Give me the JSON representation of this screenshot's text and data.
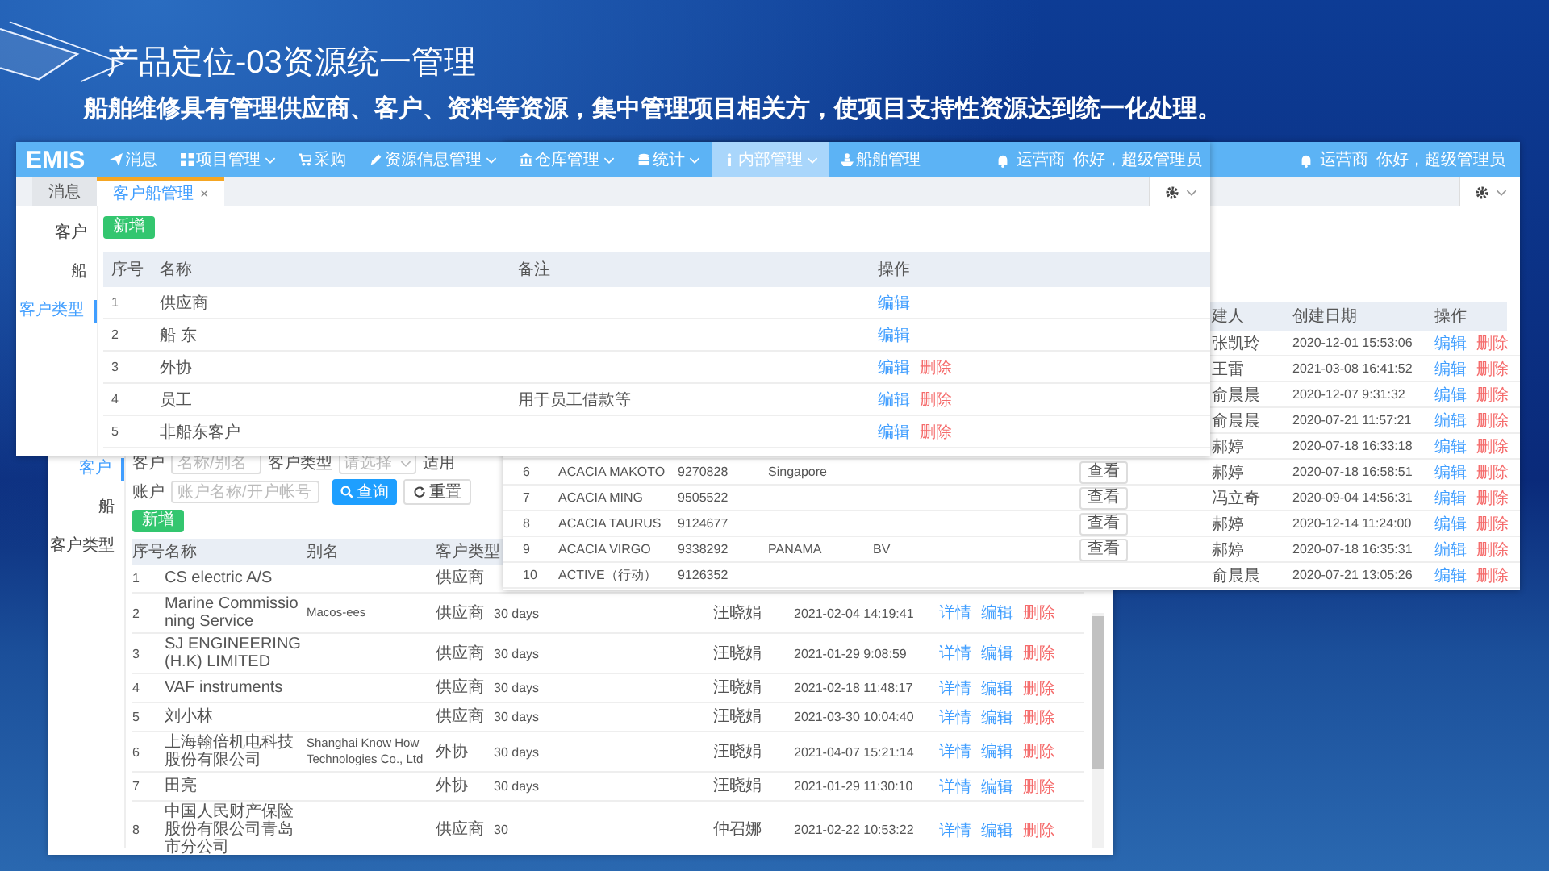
{
  "slide": {
    "title": "产品定位-03资源统一管理",
    "subtitle": "船舶维修具有管理供应商、客户、资料等资源，集中管理项目相关方，使项目支持性资源达到统一化处理。"
  },
  "customer_type_window": {
    "logo": "EMIS",
    "menu": [
      {
        "label": "消息",
        "dropdown": false,
        "selected": false
      },
      {
        "label": "项目管理",
        "dropdown": true,
        "selected": false
      },
      {
        "label": "采购",
        "dropdown": false,
        "selected": false
      },
      {
        "label": "资源信息管理",
        "dropdown": true,
        "selected": false
      },
      {
        "label": "仓库管理",
        "dropdown": true,
        "selected": false
      },
      {
        "label": "统计",
        "dropdown": true,
        "selected": false
      },
      {
        "label": "内部管理",
        "dropdown": true,
        "selected": true
      },
      {
        "label": "船舶管理",
        "dropdown": false,
        "selected": false
      }
    ],
    "operator": "运营商",
    "greeting": "你好，超级管理员",
    "tabs": [
      {
        "label": "消息",
        "selected": false
      },
      {
        "label": "客户船管理",
        "selected": true,
        "close": "×"
      }
    ],
    "sidebar": [
      {
        "label": "客户",
        "selected": false
      },
      {
        "label": "船",
        "selected": false
      },
      {
        "label": "客户类型",
        "selected": true
      }
    ],
    "add_button": "新增",
    "columns": [
      "序号",
      "名称",
      "备注",
      "操作"
    ],
    "rows": [
      {
        "number": "1",
        "name": "供应商",
        "remark": "",
        "actions": [
          {
            "label": "编辑",
            "kind": "edit"
          }
        ]
      },
      {
        "number": "2",
        "name": "船 东",
        "remark": "",
        "actions": [
          {
            "label": "编辑",
            "kind": "edit"
          }
        ]
      },
      {
        "number": "3",
        "name": "外协",
        "remark": "",
        "actions": [
          {
            "label": "编辑",
            "kind": "edit"
          },
          {
            "label": "删除",
            "kind": "delete"
          }
        ]
      },
      {
        "number": "4",
        "name": "员工",
        "remark": "用于员工借款等",
        "actions": [
          {
            "label": "编辑",
            "kind": "edit"
          },
          {
            "label": "删除",
            "kind": "delete"
          }
        ]
      },
      {
        "number": "5",
        "name": "非船东客户",
        "remark": "",
        "actions": [
          {
            "label": "编辑",
            "kind": "edit"
          },
          {
            "label": "删除",
            "kind": "delete"
          }
        ]
      }
    ]
  },
  "ship_window": {
    "operator": "运营商",
    "greeting": "你好，超级管理员",
    "columns": [
      "建人",
      "创建日期",
      "操作"
    ],
    "rows": [
      {
        "creator": "张凯玲",
        "created": "2020-12-01 15:53:06",
        "actions": [
          {
            "label": "编辑",
            "kind": "edit"
          },
          {
            "label": "删除",
            "kind": "delete"
          }
        ]
      },
      {
        "creator": "王雷",
        "created": "2021-03-08 16:41:52",
        "actions": [
          {
            "label": "编辑",
            "kind": "edit"
          },
          {
            "label": "删除",
            "kind": "delete"
          }
        ]
      },
      {
        "creator": "俞晨晨",
        "created": "2020-12-07 9:31:32",
        "actions": [
          {
            "label": "编辑",
            "kind": "edit"
          },
          {
            "label": "删除",
            "kind": "delete"
          }
        ]
      },
      {
        "creator": "俞晨晨",
        "created": "2020-07-21 11:57:21",
        "actions": [
          {
            "label": "编辑",
            "kind": "edit"
          },
          {
            "label": "删除",
            "kind": "delete"
          }
        ]
      },
      {
        "creator": "郝婷",
        "created": "2020-07-18 16:33:18",
        "actions": [
          {
            "label": "编辑",
            "kind": "edit"
          },
          {
            "label": "删除",
            "kind": "delete"
          }
        ]
      },
      {
        "number": "6",
        "name": "ACACIA MAKOTO",
        "imo": "9270828",
        "country": "Singapore",
        "view_button": "查看",
        "creator": "郝婷",
        "created": "2020-07-18 16:58:51",
        "actions": [
          {
            "label": "编辑",
            "kind": "edit"
          },
          {
            "label": "删除",
            "kind": "delete"
          }
        ]
      },
      {
        "number": "7",
        "name": "ACACIA MING",
        "imo": "9505522",
        "view_button": "查看",
        "creator": "冯立奇",
        "created": "2020-09-04 14:56:31",
        "actions": [
          {
            "label": "编辑",
            "kind": "edit"
          },
          {
            "label": "删除",
            "kind": "delete"
          }
        ]
      },
      {
        "number": "8",
        "name": "ACACIA TAURUS",
        "imo": "9124677",
        "view_button": "查看",
        "creator": "郝婷",
        "created": "2020-12-14 11:24:00",
        "actions": [
          {
            "label": "编辑",
            "kind": "edit"
          },
          {
            "label": "删除",
            "kind": "delete"
          }
        ]
      },
      {
        "number": "9",
        "name": "ACACIA VIRGO",
        "imo": "9338292",
        "country": "PANAMA",
        "flag": "BV",
        "view_button": "查看",
        "creator": "郝婷",
        "created": "2020-07-18 16:35:31",
        "actions": [
          {
            "label": "编辑",
            "kind": "edit"
          },
          {
            "label": "删除",
            "kind": "delete"
          }
        ]
      },
      {
        "number": "10",
        "name": "ACTIVE（行动）",
        "imo": "9126352",
        "creator": "俞晨晨",
        "created": "2020-07-21 13:05:26",
        "actions": [
          {
            "label": "编辑",
            "kind": "edit"
          },
          {
            "label": "删除",
            "kind": "delete"
          }
        ]
      }
    ]
  },
  "customer_window": {
    "sidebar": [
      {
        "label": "客户",
        "selected": true
      },
      {
        "label": "船",
        "selected": false
      },
      {
        "label": "客户类型",
        "selected": false
      }
    ],
    "filter_rows": [
      [
        {
          "kind": "input",
          "label": "客户",
          "placeholder": "名称/别名"
        },
        {
          "kind": "select",
          "label": "客户类型",
          "placeholder": "请选择"
        },
        {
          "kind": "cut_label",
          "label": "适用"
        }
      ],
      [
        {
          "kind": "input",
          "label": "账户",
          "placeholder": "账户名称/开户帐号"
        },
        {
          "kind": "search_button",
          "label": "查询"
        },
        {
          "kind": "reset_button",
          "label": "重置"
        }
      ]
    ],
    "add_button": "新增",
    "columns": [
      "序号",
      "名称",
      "别名",
      "客户类型"
    ],
    "rows": [
      {
        "number": "1",
        "name": "CS electric A/S",
        "alias": "",
        "type": "供应商"
      },
      {
        "number": "2",
        "name": "Marine Commissioning Service",
        "alias": "Macos-ees",
        "type": "供应商",
        "terms": "30 days",
        "person": "汪晓娟",
        "date": "2021-02-04 14:19:41",
        "actions": [
          {
            "label": "详情",
            "kind": "detail"
          },
          {
            "label": "编辑",
            "kind": "edit"
          },
          {
            "label": "删除",
            "kind": "delete"
          }
        ]
      },
      {
        "number": "3",
        "name": "SJ ENGINEERING(H.K) LIMITED",
        "alias": "",
        "type": "供应商",
        "terms": "30 days",
        "person": "汪晓娟",
        "date": "2021-01-29 9:08:59",
        "actions": [
          {
            "label": "详情",
            "kind": "detail"
          },
          {
            "label": "编辑",
            "kind": "edit"
          },
          {
            "label": "删除",
            "kind": "delete"
          }
        ]
      },
      {
        "number": "4",
        "name": "VAF instruments",
        "alias": "",
        "type": "供应商",
        "terms": "30 days",
        "person": "汪晓娟",
        "date": "2021-02-18 11:48:17",
        "actions": [
          {
            "label": "详情",
            "kind": "detail"
          },
          {
            "label": "编辑",
            "kind": "edit"
          },
          {
            "label": "删除",
            "kind": "delete"
          }
        ]
      },
      {
        "number": "5",
        "name": "刘小林",
        "alias": "",
        "type": "供应商",
        "terms": "30 days",
        "person": "汪晓娟",
        "date": "2021-03-30 10:04:40",
        "actions": [
          {
            "label": "详情",
            "kind": "detail"
          },
          {
            "label": "编辑",
            "kind": "edit"
          },
          {
            "label": "删除",
            "kind": "delete"
          }
        ]
      },
      {
        "number": "6",
        "name": "上海翰倍机电科技股份有限公司",
        "alias": "Shanghai Know How Technologies Co., Ltd",
        "type": "外协",
        "terms": "30 days",
        "person": "汪晓娟",
        "date": "2021-04-07 15:21:14",
        "actions": [
          {
            "label": "详情",
            "kind": "detail"
          },
          {
            "label": "编辑",
            "kind": "edit"
          },
          {
            "label": "删除",
            "kind": "delete"
          }
        ]
      },
      {
        "number": "7",
        "name": "田亮",
        "alias": "",
        "type": "外协",
        "terms": "30 days",
        "person": "汪晓娟",
        "date": "2021-01-29 11:30:10",
        "actions": [
          {
            "label": "详情",
            "kind": "detail"
          },
          {
            "label": "编辑",
            "kind": "edit"
          },
          {
            "label": "删除",
            "kind": "delete"
          }
        ]
      },
      {
        "number": "8",
        "name": "中国人民财产保险股份有限公司青岛市分公司",
        "alias": "",
        "type": "供应商",
        "terms": "30",
        "person": "仲召娜",
        "date": "2021-02-22 10:53:22",
        "actions": [
          {
            "label": "详情",
            "kind": "detail"
          },
          {
            "label": "编辑",
            "kind": "edit"
          },
          {
            "label": "删除",
            "kind": "delete"
          }
        ]
      }
    ]
  }
}
